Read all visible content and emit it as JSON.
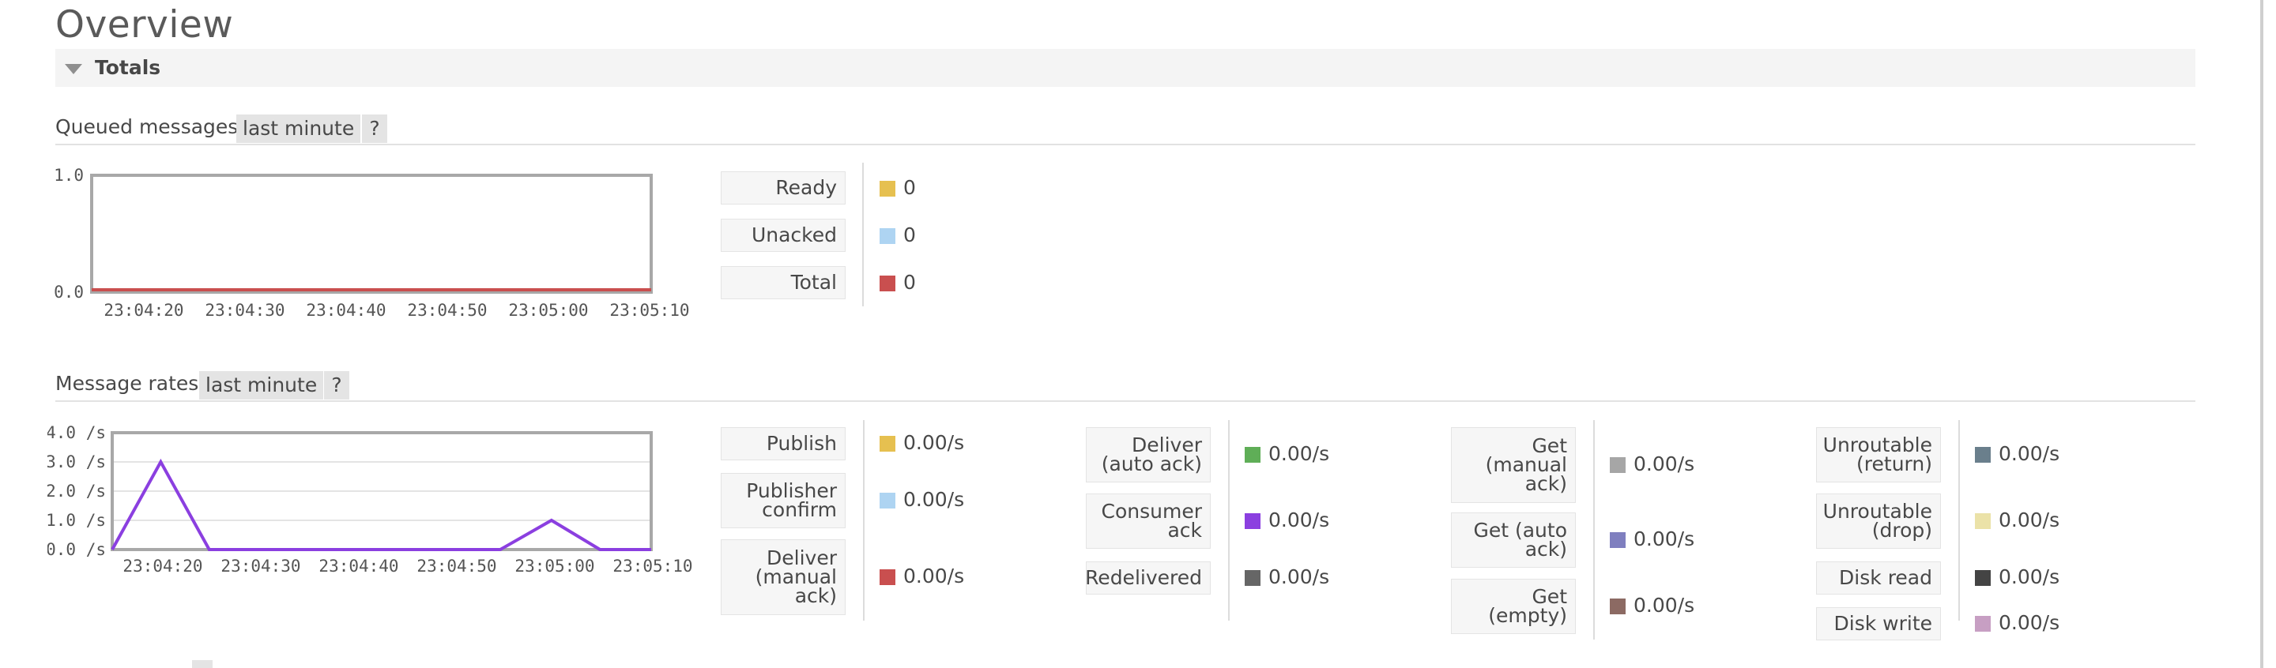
{
  "page": {
    "title": "Overview"
  },
  "totals": {
    "label": "Totals"
  },
  "queued": {
    "title": "Queued messages",
    "range": "last minute",
    "help": "?",
    "legend": [
      {
        "label": "Ready",
        "value": "0",
        "color": "#e6c050"
      },
      {
        "label": "Unacked",
        "value": "0",
        "color": "#aed4f2"
      },
      {
        "label": "Total",
        "value": "0",
        "color": "#c94f4f"
      }
    ]
  },
  "rates": {
    "title": "Message rates",
    "range": "last minute",
    "help": "?",
    "columns": [
      [
        {
          "label": "Publish",
          "value": "0.00/s",
          "color": "#e6c050"
        },
        {
          "label": "Publisher\nconfirm",
          "value": "0.00/s",
          "color": "#aed4f2"
        },
        {
          "label": "Deliver\n(manual\nack)",
          "value": "0.00/s",
          "color": "#c94f4f"
        }
      ],
      [
        {
          "label": "Deliver\n(auto ack)",
          "value": "0.00/s",
          "color": "#5fae57"
        },
        {
          "label": "Consumer\nack",
          "value": "0.00/s",
          "color": "#8b3fe0"
        },
        {
          "label": "Redelivered",
          "value": "0.00/s",
          "color": "#666666"
        }
      ],
      [
        {
          "label": "Get\n(manual\nack)",
          "value": "0.00/s",
          "color": "#a6a6a6"
        },
        {
          "label": "Get (auto\nack)",
          "value": "0.00/s",
          "color": "#7f7fbf"
        },
        {
          "label": "Get\n(empty)",
          "value": "0.00/s",
          "color": "#8c6a63"
        }
      ],
      [
        {
          "label": "Unroutable\n(return)",
          "value": "0.00/s",
          "color": "#6a7f8c"
        },
        {
          "label": "Unroutable\n(drop)",
          "value": "0.00/s",
          "color": "#ebe2a8"
        },
        {
          "label": "Disk read",
          "value": "0.00/s",
          "color": "#444444"
        },
        {
          "label": "Disk write",
          "value": "0.00/s",
          "color": "#c79fc3"
        }
      ]
    ]
  },
  "chart_data": [
    {
      "type": "line",
      "title": "",
      "x": [
        "23:04:20",
        "23:04:30",
        "23:04:40",
        "23:04:50",
        "23:05:00",
        "23:05:10"
      ],
      "ylim": [
        0,
        1
      ],
      "yticks": [
        "1.0",
        "0.0"
      ],
      "series": [
        {
          "name": "Total",
          "color": "#c94f4f",
          "x": [
            0,
            1
          ],
          "y": [
            0,
            0
          ]
        }
      ],
      "grid": false,
      "legend": "right"
    },
    {
      "type": "line",
      "title": "",
      "x": [
        "23:04:20",
        "23:04:30",
        "23:04:40",
        "23:04:50",
        "23:05:00",
        "23:05:10"
      ],
      "ylim": [
        0,
        4
      ],
      "yticks": [
        "4.0 /s",
        "3.0 /s",
        "2.0 /s",
        "1.0 /s",
        "0.0 /s"
      ],
      "series": [
        {
          "name": "Consumer ack",
          "color": "#8b3fe0",
          "x": [
            0,
            0.09,
            0.18,
            0.72,
            0.815,
            0.905,
            1.0
          ],
          "y": [
            0,
            3,
            0,
            0,
            1,
            0,
            0
          ]
        }
      ],
      "grid": true,
      "legend": "right"
    }
  ]
}
